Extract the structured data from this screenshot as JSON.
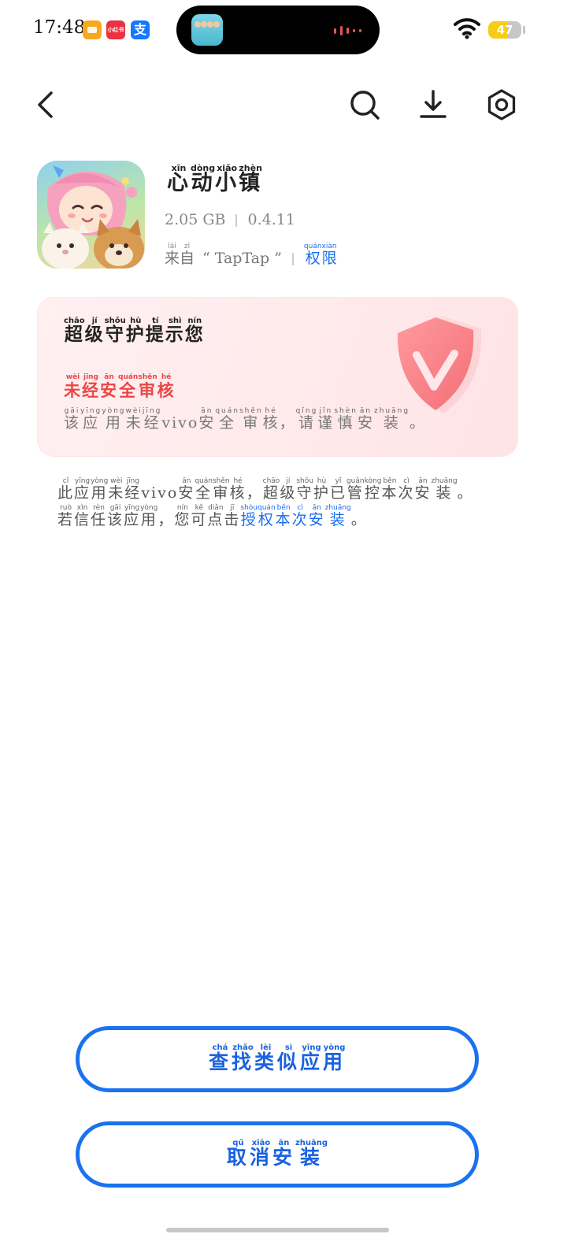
{
  "status_bar": {
    "time": "17:48",
    "apps": [
      {
        "name": "yellow-app",
        "color": "#f7a91d",
        "glyph": ""
      },
      {
        "name": "xiaohongshu",
        "color": "#ec3140",
        "glyph": "小红书"
      },
      {
        "name": "alipay",
        "color": "#1677ff",
        "glyph": "支"
      }
    ],
    "battery_level": "47",
    "battery_color": "#f5cc18"
  },
  "toolbar": {
    "back": "back-icon",
    "search": "search-icon",
    "download": "download-icon",
    "settings": "settings-icon"
  },
  "app": {
    "name": [
      {
        "char": "心",
        "py": "xīn"
      },
      {
        "char": "动",
        "py": "dòng"
      },
      {
        "char": "小",
        "py": "xiǎo"
      },
      {
        "char": "镇",
        "py": "zhèn"
      }
    ],
    "size": "2.05 GB",
    "version": "0.4.11",
    "source_prefix": [
      {
        "char": "来",
        "py": "lái"
      },
      {
        "char": "自",
        "py": "zì"
      }
    ],
    "source_name": "“ TapTap ”",
    "permissions": [
      {
        "char": "权",
        "py": "quán"
      },
      {
        "char": "限",
        "py": "xiàn"
      }
    ]
  },
  "card": {
    "title": [
      {
        "char": "超",
        "py": "chāo"
      },
      {
        "char": "级",
        "py": "jí"
      },
      {
        "char": "守",
        "py": "shǒu"
      },
      {
        "char": "护",
        "py": "hù"
      },
      {
        "char": "提",
        "py": "tí"
      },
      {
        "char": "示",
        "py": "shì"
      },
      {
        "char": "您",
        "py": "nín"
      }
    ],
    "warning": [
      {
        "char": "未",
        "py": "wèi"
      },
      {
        "char": "经",
        "py": "jīng"
      },
      {
        "char": "安",
        "py": "ān"
      },
      {
        "char": "全",
        "py": "quán"
      },
      {
        "char": "审",
        "py": "shěn"
      },
      {
        "char": "核",
        "py": "hé"
      }
    ],
    "description": [
      {
        "char": "该",
        "py": "gāi"
      },
      {
        "char": "应",
        "py": "yīng"
      },
      {
        "char": "用",
        "py": "yòng"
      },
      {
        "char": "未",
        "py": "wèi"
      },
      {
        "char": "经",
        "py": "jīng"
      },
      {
        "char": "vivo",
        "py": ""
      },
      {
        "char": "安",
        "py": "ān"
      },
      {
        "char": "全",
        "py": "quán"
      },
      {
        "char": "审",
        "py": "shěn"
      },
      {
        "char": "核",
        "py": "hé"
      },
      {
        "char": "，",
        "py": ""
      },
      {
        "char": "请",
        "py": "qǐng"
      },
      {
        "char": "谨",
        "py": "jǐn"
      },
      {
        "char": "慎",
        "py": "shèn"
      },
      {
        "char": "安",
        "py": "ān"
      },
      {
        "char": "装",
        "py": "zhuāng"
      },
      {
        "char": "。",
        "py": ""
      }
    ],
    "shield_color": "#f27c80"
  },
  "notice": {
    "line1": [
      {
        "char": "此",
        "py": "cǐ"
      },
      {
        "char": "应",
        "py": "yīng"
      },
      {
        "char": "用",
        "py": "yòng"
      },
      {
        "char": "未",
        "py": "wèi"
      },
      {
        "char": "经",
        "py": "jīng"
      },
      {
        "char": "vivo",
        "py": ""
      },
      {
        "char": "安",
        "py": "ān"
      },
      {
        "char": "全",
        "py": "quán"
      },
      {
        "char": "审",
        "py": "shěn"
      },
      {
        "char": "核",
        "py": "hé"
      },
      {
        "char": "，",
        "py": ""
      },
      {
        "char": "超",
        "py": "chāo"
      },
      {
        "char": "级",
        "py": "jí"
      },
      {
        "char": "守",
        "py": "shǒu"
      },
      {
        "char": "护",
        "py": "hù"
      },
      {
        "char": "已",
        "py": "yǐ"
      },
      {
        "char": "管",
        "py": "guǎn"
      },
      {
        "char": "控",
        "py": "kòng"
      },
      {
        "char": "本",
        "py": "běn"
      },
      {
        "char": "次",
        "py": "cì"
      },
      {
        "char": "安",
        "py": "ān"
      },
      {
        "char": "装",
        "py": "zhuāng"
      },
      {
        "char": "。",
        "py": ""
      }
    ],
    "line2": [
      {
        "char": "若",
        "py": "ruò"
      },
      {
        "char": "信",
        "py": "xìn"
      },
      {
        "char": "任",
        "py": "rèn"
      },
      {
        "char": "该",
        "py": "gāi"
      },
      {
        "char": "应",
        "py": "yīng"
      },
      {
        "char": "用",
        "py": "yòng"
      },
      {
        "char": "，",
        "py": ""
      },
      {
        "char": "您",
        "py": "nín"
      },
      {
        "char": "可",
        "py": "kě"
      },
      {
        "char": "点",
        "py": "diǎn"
      },
      {
        "char": "击",
        "py": "jī"
      }
    ],
    "link": [
      {
        "char": "授",
        "py": "shòu"
      },
      {
        "char": "权",
        "py": "quán"
      },
      {
        "char": "本",
        "py": "běn"
      },
      {
        "char": "次",
        "py": "cì"
      },
      {
        "char": "安",
        "py": "ān"
      },
      {
        "char": "装",
        "py": "zhuāng"
      }
    ],
    "link_end": "。"
  },
  "buttons": {
    "find_similar": [
      {
        "char": "查",
        "py": "chá"
      },
      {
        "char": "找",
        "py": "zhǎo"
      },
      {
        "char": "类",
        "py": "lèi"
      },
      {
        "char": "似",
        "py": "sì"
      },
      {
        "char": "应",
        "py": "yīng"
      },
      {
        "char": "用",
        "py": "yòng"
      }
    ],
    "cancel_install": [
      {
        "char": "取",
        "py": "qǔ"
      },
      {
        "char": "消",
        "py": "xiāo"
      },
      {
        "char": "安",
        "py": "ān"
      },
      {
        "char": "装",
        "py": "zhuāng"
      }
    ],
    "accent": "#1a72f0"
  }
}
